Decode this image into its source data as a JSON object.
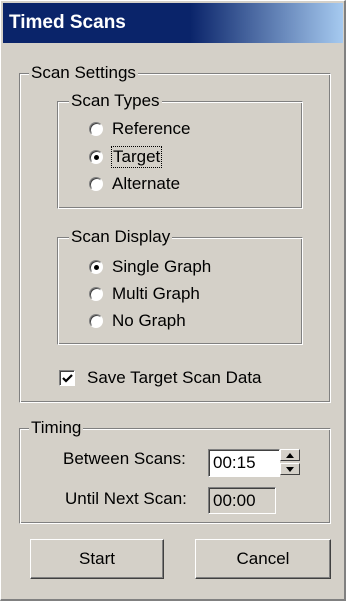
{
  "window": {
    "title": "Timed Scans"
  },
  "scan_settings": {
    "legend": "Scan Settings",
    "scan_types": {
      "legend": "Scan Types",
      "options": [
        {
          "label": "Reference",
          "checked": false
        },
        {
          "label": "Target",
          "checked": true
        },
        {
          "label": "Alternate",
          "checked": false
        }
      ]
    },
    "scan_display": {
      "legend": "Scan Display",
      "options": [
        {
          "label": "Single Graph",
          "checked": true
        },
        {
          "label": "Multi Graph",
          "checked": false
        },
        {
          "label": "No Graph",
          "checked": false
        }
      ]
    },
    "save_target": {
      "label": "Save Target Scan Data",
      "checked": true
    }
  },
  "timing": {
    "legend": "Timing",
    "between_label": "Between Scans:",
    "between_value": "00:15",
    "until_label": "Until Next Scan:",
    "until_value": "00:00"
  },
  "buttons": {
    "start": "Start",
    "cancel": "Cancel"
  }
}
